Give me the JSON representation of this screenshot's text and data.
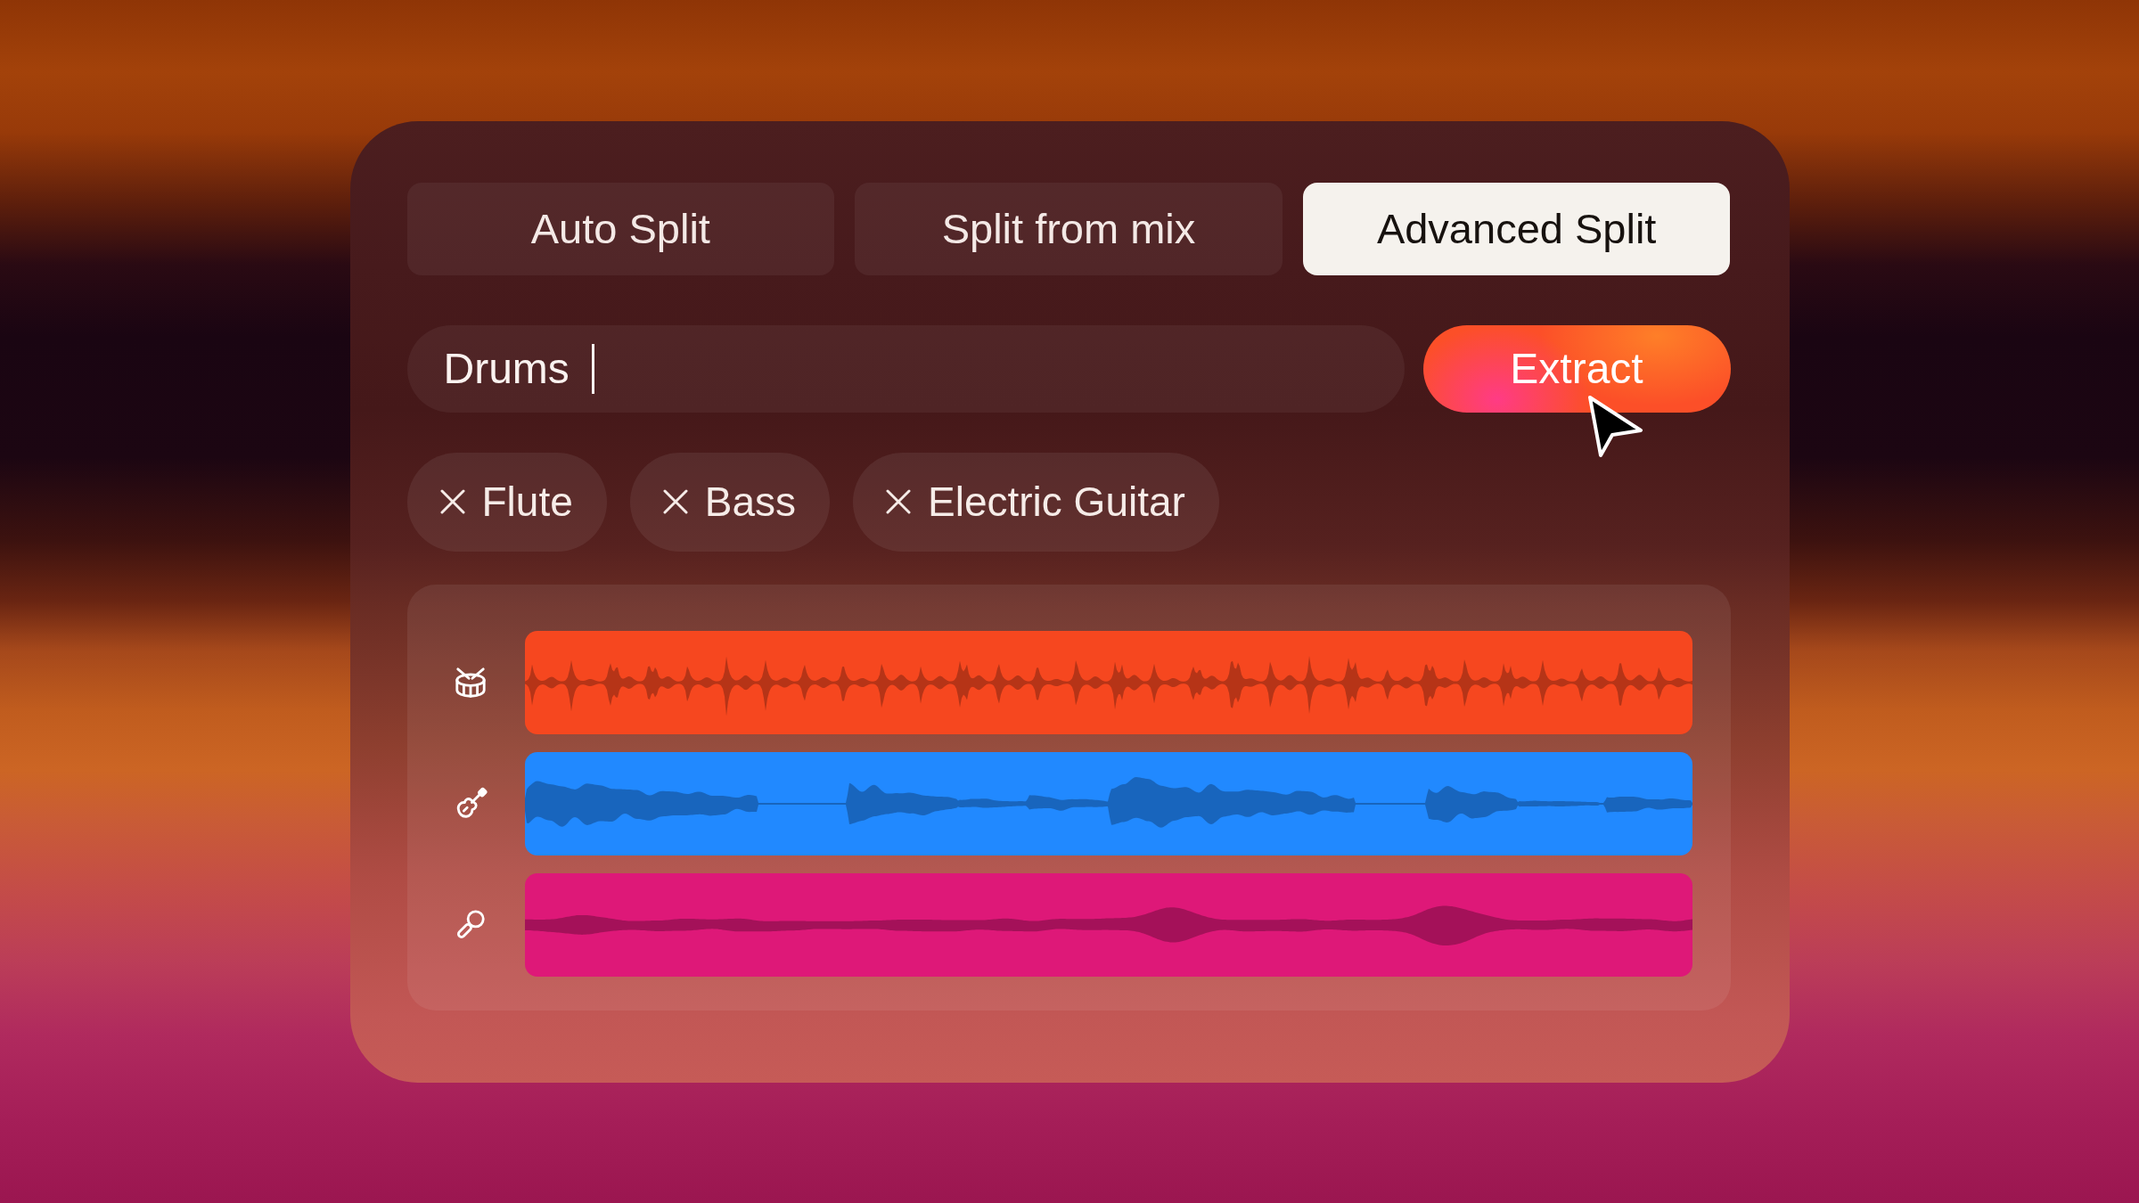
{
  "tabs": [
    {
      "label": "Auto Split",
      "selected": false
    },
    {
      "label": "Split from mix",
      "selected": false
    },
    {
      "label": "Advanced Split",
      "selected": true
    }
  ],
  "prompt": {
    "value": "Drums",
    "focused": true
  },
  "extract_button": {
    "label": "Extract"
  },
  "tags": [
    {
      "label": "Flute"
    },
    {
      "label": "Bass"
    },
    {
      "label": "Electric Guitar"
    }
  ],
  "tracks": [
    {
      "kind": "drums",
      "color": "#f6471f"
    },
    {
      "kind": "guitar",
      "color": "#2189ff"
    },
    {
      "kind": "vocals",
      "color": "#de1878"
    }
  ]
}
